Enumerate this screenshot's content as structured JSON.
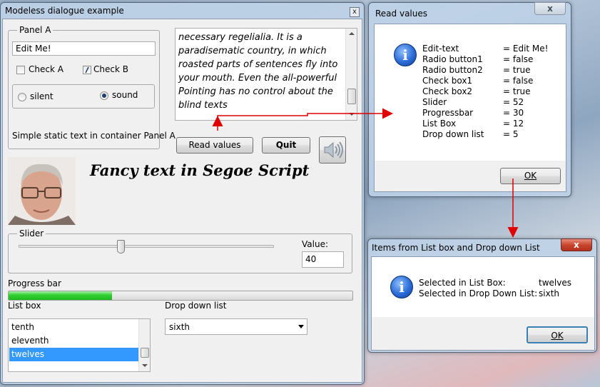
{
  "main_window": {
    "title": "Modeless dialogue example",
    "close_glyph": "x",
    "panel_a": {
      "label": "Panel A",
      "edit_value": "Edit Me!",
      "check_a": "Check A",
      "check_b": "Check B",
      "radio_silent": "silent",
      "radio_sound": "sound",
      "static_text": "Simple static text in container Panel A"
    },
    "memo_lines": [
      "necessary regelialia. It is a",
      "paradisematic country, in which",
      "roasted parts of sentences fly into",
      "your mouth.  Even the all-powerful",
      "Pointing has no control about the",
      "blind texts"
    ],
    "read_values_button": "Read values",
    "quit_button": "Quit",
    "fancy_text": "Fancy text in Segoe Script",
    "slider": {
      "label": "Slider",
      "value": 40,
      "max": 100,
      "value_label": "Value:",
      "value_text": "40"
    },
    "progress": {
      "label": "Progress bar",
      "value": 30
    },
    "listbox": {
      "label": "List box",
      "items": [
        "tenth",
        "eleventh",
        "twelves"
      ],
      "selected": "twelves"
    },
    "dropdown": {
      "label": "Drop down list",
      "value": "sixth"
    }
  },
  "read_values_window": {
    "title": "Read values",
    "close_glyph": "x",
    "rows": [
      {
        "key": "Edit-text",
        "value": "= Edit Me!"
      },
      {
        "key": "Radio button1",
        "value": "= false"
      },
      {
        "key": "Radio button2",
        "value": "= true"
      },
      {
        "key": "Check box1",
        "value": "= false"
      },
      {
        "key": "Check box2",
        "value": "= true"
      },
      {
        "key": "Slider",
        "value": "= 52"
      },
      {
        "key": "Progressbar",
        "value": "= 30"
      },
      {
        "key": "List Box",
        "value": "= 12"
      },
      {
        "key": "Drop down list",
        "value": "= 5"
      }
    ],
    "ok_button": "OK"
  },
  "items_window": {
    "title": "Items from List box and Drop down List",
    "close_glyph": "x",
    "rows": [
      {
        "key": "Selected in List Box:",
        "value": "twelves"
      },
      {
        "key": "Selected in Drop Down List:",
        "value": "sixth"
      }
    ],
    "ok_button": "OK"
  },
  "colors": {
    "arrow": "#e00000",
    "progress_fill": "#2ed02e",
    "selection": "#3399ff",
    "info_icon": "#2a6cd6"
  },
  "icons": {
    "info": "info-icon",
    "speaker": "speaker-icon",
    "combo_arrow": "chevron-down-icon"
  }
}
